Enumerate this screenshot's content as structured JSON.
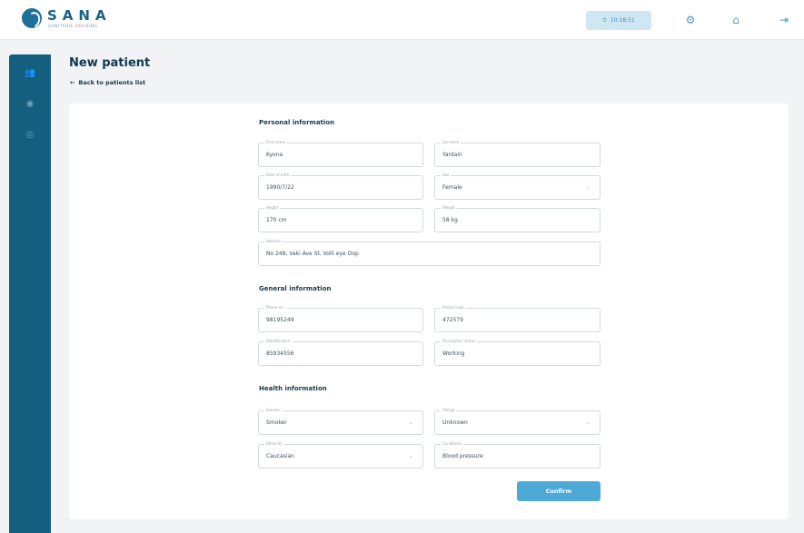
{
  "brand": {
    "name": "SANA",
    "tagline": "SANITARIE HOLDING"
  },
  "header": {
    "time": "10:18:51"
  },
  "page": {
    "title": "New patient",
    "back_label": "Back to patients list"
  },
  "sections": {
    "personal": "Personal information",
    "general": "General information",
    "health": "Health information"
  },
  "fields": {
    "first_name": {
      "label": "First name",
      "value": "Kyona"
    },
    "surname": {
      "label": "Surname",
      "value": "Yardain"
    },
    "dob": {
      "label": "Date of birth",
      "value": "1990/7/22"
    },
    "sex": {
      "label": "Sex",
      "value": "Female"
    },
    "height": {
      "label": "Height",
      "value": "170 cm"
    },
    "weight": {
      "label": "Weight",
      "value": "58 kg"
    },
    "address": {
      "label": "Address",
      "value": "No 248, Vaki Ave St. Volli eye Oop"
    },
    "phone": {
      "label": "Phone no.",
      "value": "98195249"
    },
    "postal_code": {
      "label": "Postal Code",
      "value": "472579"
    },
    "id_number": {
      "label": "Identification",
      "value": "85934556"
    },
    "occupation": {
      "label": "Occupation status",
      "value": "Working"
    },
    "smoker": {
      "label": "Smoker",
      "value": "Smoker"
    },
    "allergy": {
      "label": "Allergy",
      "value": "Unknown"
    },
    "ethnicity": {
      "label": "Ethnicity",
      "value": "Caucasian"
    },
    "conditions": {
      "label": "Conditions",
      "value": "Blood pressure"
    }
  },
  "buttons": {
    "confirm": "Confirm"
  },
  "icons": {
    "logo": "sana-logo-icon",
    "clock": "clock-icon",
    "settings": "gear-icon",
    "home": "home-icon",
    "logout": "logout-icon",
    "patients": "users-icon",
    "nav2": "circle-icon",
    "nav3": "circle-icon",
    "back": "arrow-left-icon",
    "dropdown": "chevron-down-icon"
  },
  "colors": {
    "brand": "#1e6f9a",
    "sidebar": "#145f7f",
    "accent": "#4ea9d6",
    "time_pill_bg": "#cfe7f3"
  }
}
